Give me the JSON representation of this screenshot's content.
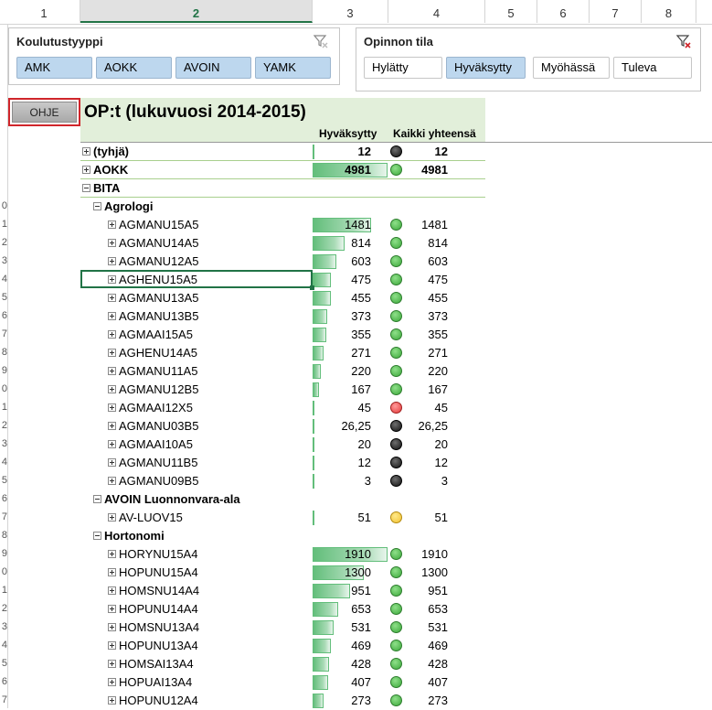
{
  "columns": [
    "1",
    "2",
    "3",
    "4",
    "5",
    "6",
    "7",
    "8"
  ],
  "row_numbers": [
    "0",
    "1",
    "2",
    "3",
    "4",
    "5",
    "6",
    "7",
    "8",
    "9",
    "0",
    "1",
    "2",
    "3",
    "4",
    "5",
    "6",
    "7",
    "8",
    "9",
    "0",
    "1",
    "2",
    "3",
    "4",
    "5",
    "6",
    "7"
  ],
  "slicer_left": {
    "title": "Koulutustyyppi",
    "items": [
      {
        "label": "AMK",
        "selected": true
      },
      {
        "label": "AOKK",
        "selected": true
      },
      {
        "label": "AVOIN",
        "selected": true
      },
      {
        "label": "YAMK",
        "selected": true
      }
    ]
  },
  "slicer_right": {
    "title": "Opinnon tila",
    "items": [
      {
        "label": "Hylätty",
        "selected": false
      },
      {
        "label": "Hyväksytty",
        "selected": true
      },
      {
        "label": "Myöhässä",
        "selected": false
      },
      {
        "label": "Tuleva",
        "selected": false
      }
    ]
  },
  "ohje_button": "OHJE",
  "pivot": {
    "title": "OP:t (lukuvuosi 2014-2015)",
    "col_hyvaksytty": "Hyväksytty",
    "col_total": "Kaikki yhteensä",
    "max_value": 1910,
    "rows": [
      {
        "label": "(tyhjä)",
        "level": 0,
        "expander": "plus",
        "bold": true,
        "value": 12,
        "value_text": "12",
        "total": "12",
        "status": "black"
      },
      {
        "label": "AOKK",
        "level": 0,
        "expander": "plus",
        "bold": true,
        "value": 4981,
        "value_text": "4981",
        "total": "4981",
        "status": "green"
      },
      {
        "label": "BITA",
        "level": 0,
        "expander": "minus",
        "bold": true
      },
      {
        "label": "Agrologi",
        "level": 1,
        "expander": "minus",
        "bold": true
      },
      {
        "label": "AGMANU15A5",
        "level": 2,
        "expander": "plus",
        "value": 1481,
        "value_text": "1481",
        "total": "1481",
        "status": "green"
      },
      {
        "label": "AGMANU14A5",
        "level": 2,
        "expander": "plus",
        "value": 814,
        "value_text": "814",
        "total": "814",
        "status": "green"
      },
      {
        "label": "AGMANU12A5",
        "level": 2,
        "expander": "plus",
        "value": 603,
        "value_text": "603",
        "total": "603",
        "status": "green"
      },
      {
        "label": "AGHENU15A5",
        "level": 2,
        "expander": "plus",
        "value": 475,
        "value_text": "475",
        "total": "475",
        "status": "green"
      },
      {
        "label": "AGMANU13A5",
        "level": 2,
        "expander": "plus",
        "value": 455,
        "value_text": "455",
        "total": "455",
        "status": "green"
      },
      {
        "label": "AGMANU13B5",
        "level": 2,
        "expander": "plus",
        "value": 373,
        "value_text": "373",
        "total": "373",
        "status": "green"
      },
      {
        "label": "AGMAAI15A5",
        "level": 2,
        "expander": "plus",
        "value": 355,
        "value_text": "355",
        "total": "355",
        "status": "green"
      },
      {
        "label": "AGHENU14A5",
        "level": 2,
        "expander": "plus",
        "value": 271,
        "value_text": "271",
        "total": "271",
        "status": "green"
      },
      {
        "label": "AGMANU11A5",
        "level": 2,
        "expander": "plus",
        "value": 220,
        "value_text": "220",
        "total": "220",
        "status": "green"
      },
      {
        "label": "AGMANU12B5",
        "level": 2,
        "expander": "plus",
        "value": 167,
        "value_text": "167",
        "total": "167",
        "status": "green"
      },
      {
        "label": "AGMAAI12X5",
        "level": 2,
        "expander": "plus",
        "value": 45,
        "value_text": "45",
        "total": "45",
        "status": "red"
      },
      {
        "label": "AGMANU03B5",
        "level": 2,
        "expander": "plus",
        "value": 26.25,
        "value_text": "26,25",
        "total": "26,25",
        "status": "black"
      },
      {
        "label": "AGMAAI10A5",
        "level": 2,
        "expander": "plus",
        "value": 20,
        "value_text": "20",
        "total": "20",
        "status": "black"
      },
      {
        "label": "AGMANU11B5",
        "level": 2,
        "expander": "plus",
        "value": 12,
        "value_text": "12",
        "total": "12",
        "status": "black"
      },
      {
        "label": "AGMANU09B5",
        "level": 2,
        "expander": "plus",
        "value": 3,
        "value_text": "3",
        "total": "3",
        "status": "black"
      },
      {
        "label": "AVOIN Luonnonvara-ala",
        "level": 1,
        "expander": "minus",
        "bold": true
      },
      {
        "label": "AV-LUOV15",
        "level": 2,
        "expander": "plus",
        "value": 51,
        "value_text": "51",
        "total": "51",
        "status": "yellow"
      },
      {
        "label": "Hortonomi",
        "level": 1,
        "expander": "minus",
        "bold": true
      },
      {
        "label": "HORYNU15A4",
        "level": 2,
        "expander": "plus",
        "value": 1910,
        "value_text": "1910",
        "total": "1910",
        "status": "green"
      },
      {
        "label": "HOPUNU15A4",
        "level": 2,
        "expander": "plus",
        "value": 1300,
        "value_text": "1300",
        "total": "1300",
        "status": "green"
      },
      {
        "label": "HOMSNU14A4",
        "level": 2,
        "expander": "plus",
        "value": 951,
        "value_text": "951",
        "total": "951",
        "status": "green"
      },
      {
        "label": "HOPUNU14A4",
        "level": 2,
        "expander": "plus",
        "value": 653,
        "value_text": "653",
        "total": "653",
        "status": "green"
      },
      {
        "label": "HOMSNU13A4",
        "level": 2,
        "expander": "plus",
        "value": 531,
        "value_text": "531",
        "total": "531",
        "status": "green"
      },
      {
        "label": "HOPUNU13A4",
        "level": 2,
        "expander": "plus",
        "value": 469,
        "value_text": "469",
        "total": "469",
        "status": "green"
      },
      {
        "label": "HOMSAI13A4",
        "level": 2,
        "expander": "plus",
        "value": 428,
        "value_text": "428",
        "total": "428",
        "status": "green"
      },
      {
        "label": "HOPUAI13A4",
        "level": 2,
        "expander": "plus",
        "value": 407,
        "value_text": "407",
        "total": "407",
        "status": "green"
      },
      {
        "label": "HOPUNU12A4",
        "level": 2,
        "expander": "plus",
        "value": 273,
        "value_text": "273",
        "total": "273",
        "status": "green"
      }
    ]
  },
  "colors": {
    "bar_green": "#63be7b",
    "header_band": "#e2efda",
    "slicer_selected": "#bdd7ee",
    "active_column": "#217346",
    "ohje_border": "#d0262b"
  }
}
